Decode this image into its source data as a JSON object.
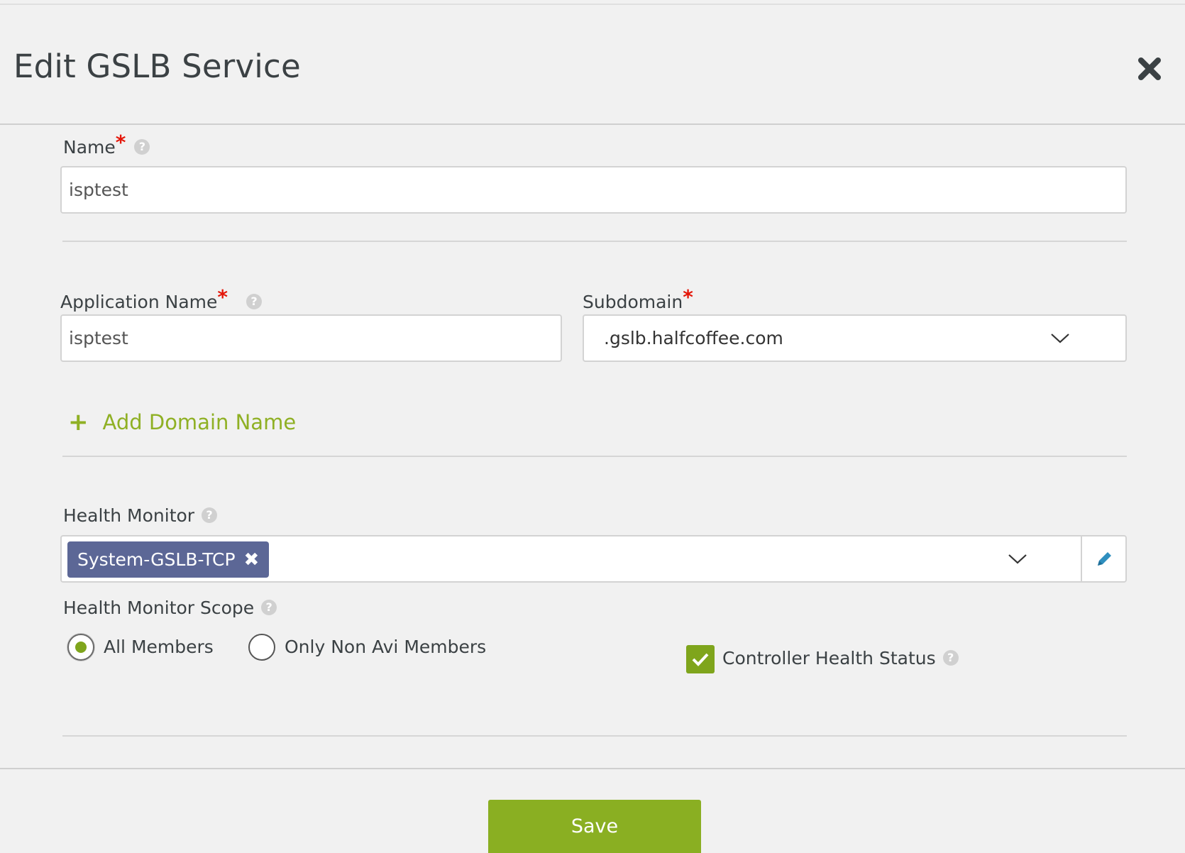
{
  "dialog": {
    "title": "Edit GSLB Service"
  },
  "name_field": {
    "label": "Name",
    "required_mark": "*",
    "value": "isptest"
  },
  "application_name": {
    "label": "Application Name",
    "required_mark": "*",
    "value": "isptest"
  },
  "subdomain": {
    "label": "Subdomain",
    "required_mark": "*",
    "selected": ".gslb.halfcoffee.com"
  },
  "add_domain": {
    "label": "Add Domain Name"
  },
  "health_monitor": {
    "label": "Health Monitor",
    "tags": [
      "System-GSLB-TCP"
    ]
  },
  "health_monitor_scope": {
    "label": "Health Monitor Scope",
    "options": [
      {
        "label": "All Members",
        "selected": true
      },
      {
        "label": "Only Non Avi Members",
        "selected": false
      }
    ]
  },
  "controller_health_status": {
    "label": "Controller Health Status",
    "checked": true
  },
  "footer": {
    "save_label": "Save"
  },
  "colors": {
    "accent_green": "#8aaf22",
    "tag_purple": "#5c6796",
    "required_red": "#e4170a"
  },
  "help_glyph": "?"
}
